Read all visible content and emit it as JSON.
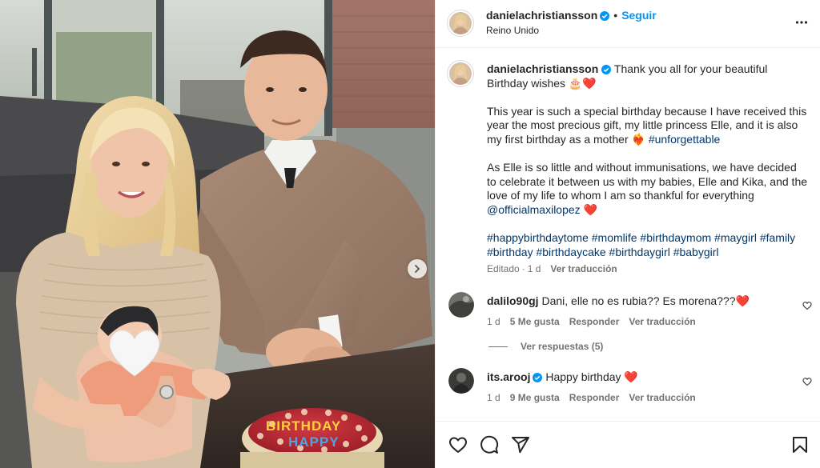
{
  "post": {
    "author": {
      "username": "danielachristiansson",
      "verified": true,
      "location": "Reino Unido",
      "follow_label": "Seguir",
      "separator": "•"
    },
    "more_icon": "more-horizontal-icon",
    "caption": {
      "username": "danielachristiansson",
      "intro": "Thank you all for your beautiful Birthday wishes 🎂❤️",
      "p2_text": "This year is such a special birthday because I have received this year the most precious gift, my little princess Elle, and it is also my first birthday as a mother ❤️‍🔥 ",
      "p2_tag": "#unforgettable",
      "p3_text": "As Elle is so little and without immunisations, we have decided to celebrate it between us with my babies, Elle and Kika, and the love of my life to whom I am so thankful for everything ",
      "p3_mention": "@officialmaxilopez",
      "p3_emoji": " ❤️",
      "hashtags": "#happybirthdaytome #momlife #birthdaymom #maygirl #family #birthday #birthdaycake #birthdaygirl #babygirl",
      "edited": "Editado",
      "separator": "·",
      "time": "1 d",
      "translate": "Ver traducción"
    },
    "comments": [
      {
        "username": "dalilo90gj",
        "text": "Dani, elle no es rubia?? Es morena???❤️",
        "time": "1 d",
        "likes": "5 Me gusta",
        "reply": "Responder",
        "translate": "Ver traducción"
      },
      {
        "username": "its.arooj",
        "verified": true,
        "text": "Happy birthday ❤️",
        "time": "1 d",
        "likes": "9 Me gusta",
        "reply": "Responder",
        "translate": "Ver traducción"
      }
    ],
    "view_replies": "Ver respuestas (5)",
    "photo": {
      "cake_text_top": "BIRTHDAY",
      "cake_text_bottom": "HAPPY"
    },
    "colors": {
      "accent": "#0095f6",
      "link": "#00376b",
      "secondary": "#737373",
      "border": "#efefef",
      "heart": "#ed4956"
    },
    "action_icons": [
      "heart-icon",
      "comment-icon",
      "share-icon",
      "bookmark-icon"
    ]
  }
}
